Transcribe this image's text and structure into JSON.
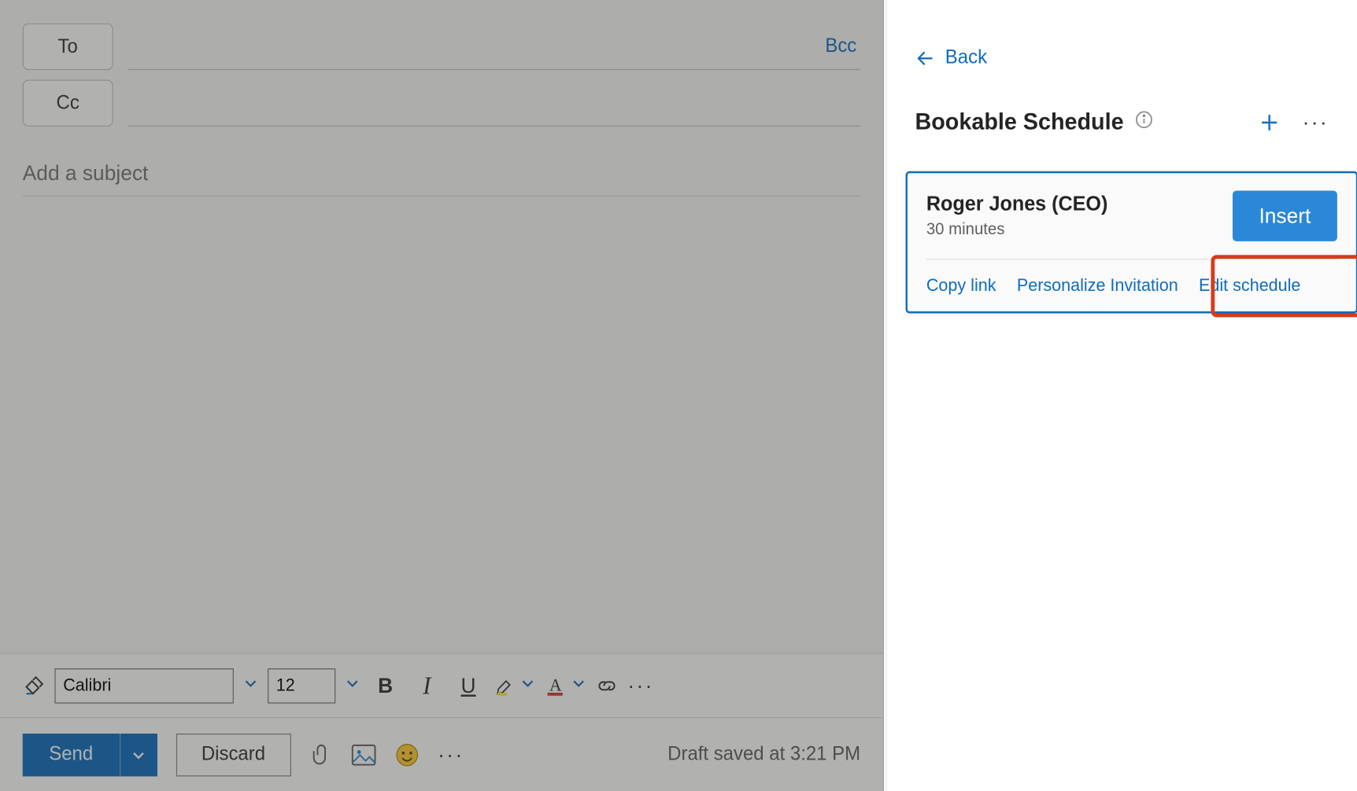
{
  "compose": {
    "to_label": "To",
    "cc_label": "Cc",
    "bcc_label": "Bcc",
    "subject_placeholder": "Add a subject"
  },
  "format": {
    "font_name": "Calibri",
    "font_size": "12"
  },
  "actions": {
    "send_label": "Send",
    "discard_label": "Discard"
  },
  "status": {
    "draft_saved": "Draft saved at 3:21 PM"
  },
  "panel": {
    "back_label": "Back",
    "title": "Bookable Schedule",
    "card": {
      "name": "Roger Jones (CEO)",
      "duration": "30 minutes",
      "insert_label": "Insert",
      "copy_link": "Copy link",
      "personalize": "Personalize Invitation",
      "edit_schedule": "Edit schedule"
    }
  }
}
